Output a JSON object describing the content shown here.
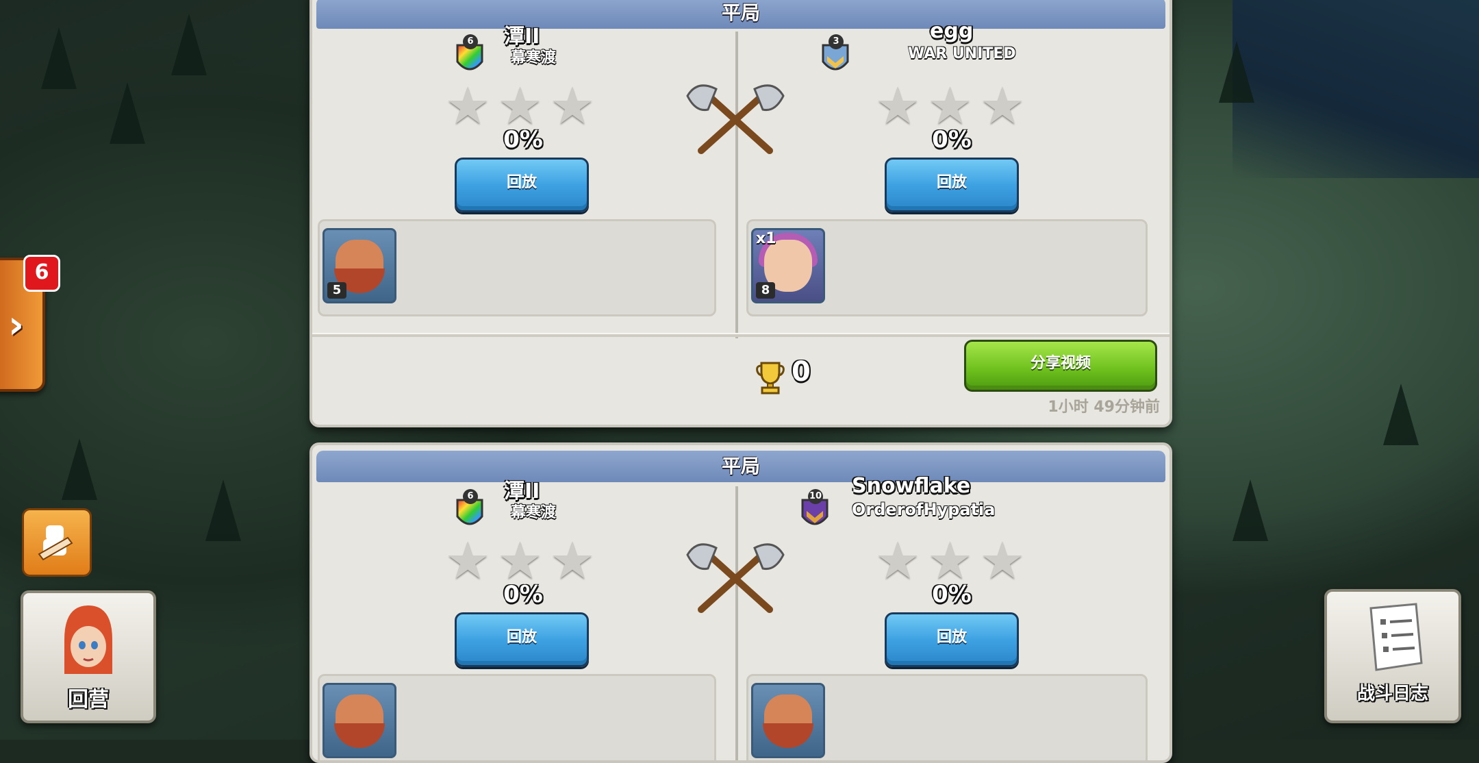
{
  "battles": [
    {
      "result": "平局",
      "attacker": {
        "name": "潭II",
        "clan": "幕寒渡",
        "clan_level": "6",
        "percent": "0%",
        "replay_label": "回放",
        "troop_count": "5",
        "troop_mult": ""
      },
      "defender": {
        "name": "egg",
        "clan": "WAR UNITED",
        "clan_level": "3",
        "percent": "0%",
        "replay_label": "回放",
        "troop_count": "8",
        "troop_mult": "x1"
      },
      "trophies": "0",
      "share_label": "分享视频",
      "time_ago": "1小时 49分钟前"
    },
    {
      "result": "平局",
      "attacker": {
        "name": "潭II",
        "clan": "幕寒渡",
        "clan_level": "6",
        "percent": "0%",
        "replay_label": "回放"
      },
      "defender": {
        "name": "Snowflake",
        "clan": "OrderofHypatia",
        "clan_level": "10",
        "percent": "0%",
        "replay_label": "回放"
      }
    }
  ],
  "hud": {
    "notification_count": "6",
    "home_label": "回营",
    "battle_log_label": "战斗日志"
  },
  "icons": {
    "expand": "chevron-right-icon",
    "builder": "builder-icon",
    "log": "battle-log-icon",
    "axes": "crossed-axes-icon",
    "trophy": "trophy-icon"
  }
}
